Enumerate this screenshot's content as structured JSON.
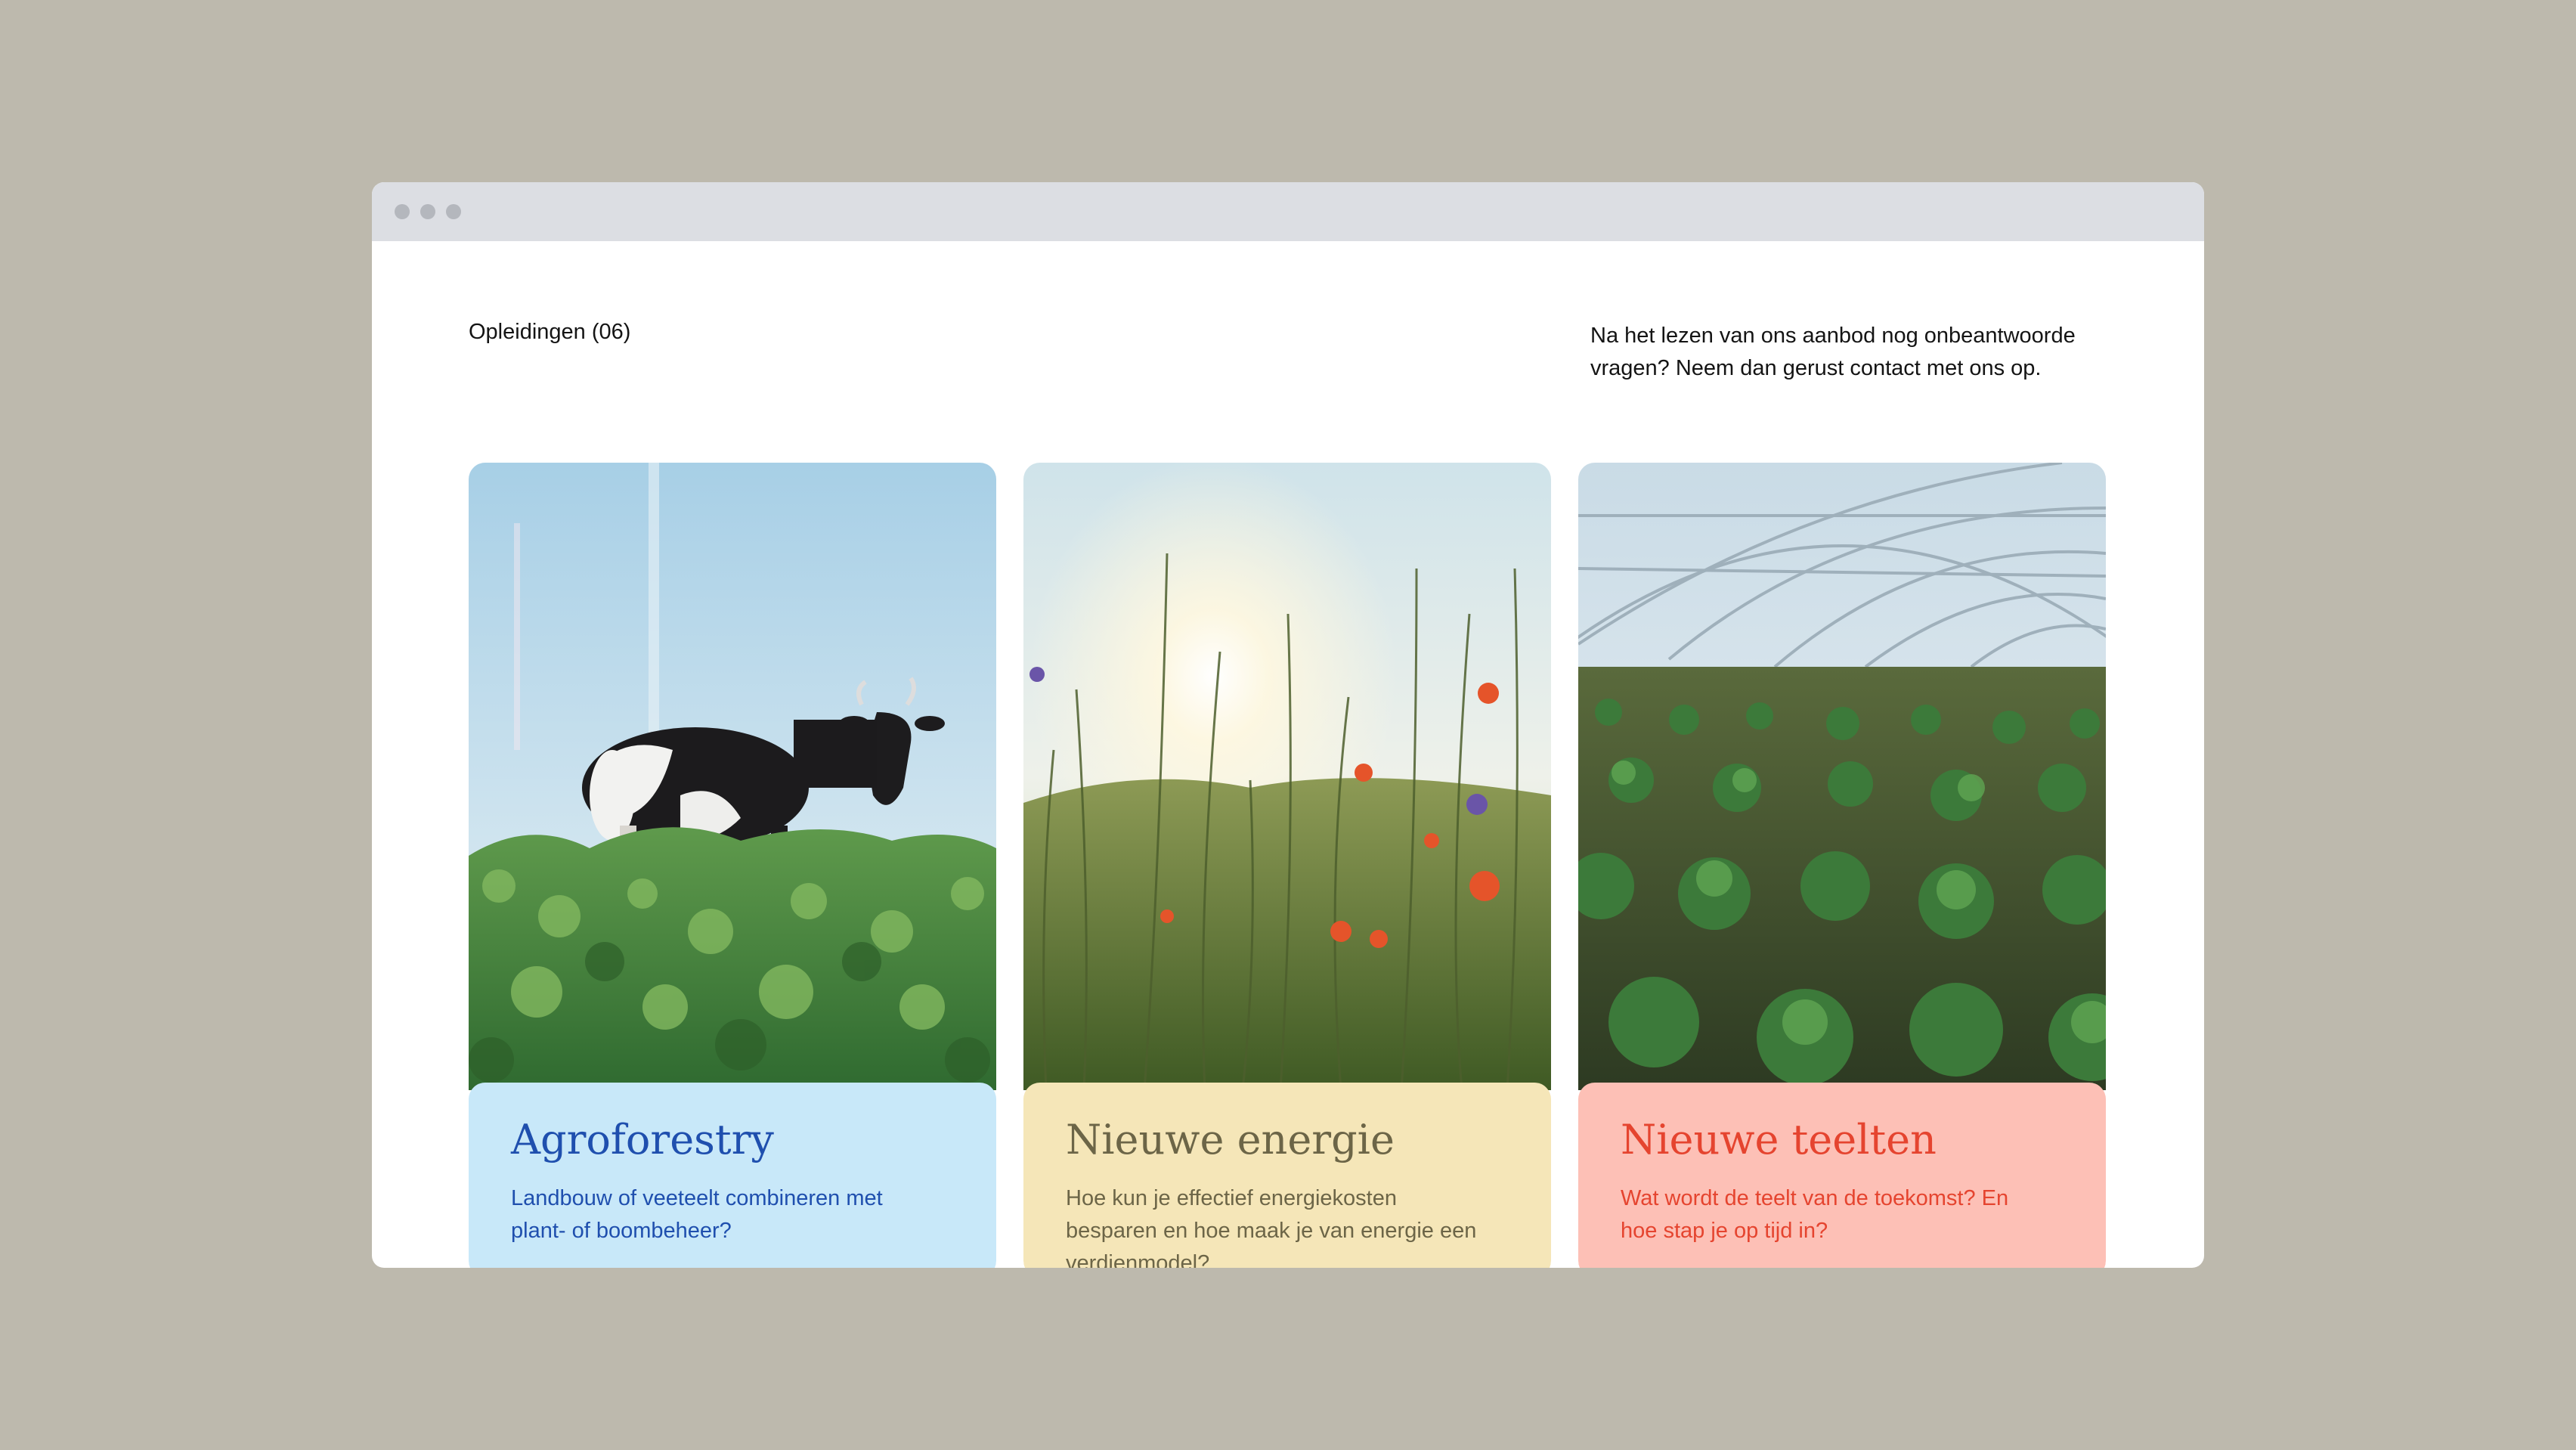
{
  "section": {
    "title": "Opleidingen (06)",
    "intro": "Na het lezen van ons aanbod nog onbeantwoorde vragen? Neem dan gerust contact met ons op."
  },
  "courses": [
    {
      "title": "Agroforestry",
      "description": "Landbouw of veeteelt combineren met plant- of boombeheer?",
      "image": "cow-in-meadow-photo",
      "color": "#c8e8f9",
      "text_color": "#1f4fae"
    },
    {
      "title": "Nieuwe energie",
      "description": "Hoe kun je effectief energiekosten besparen en hoe maak je van energie een verdienmodel?",
      "image": "wildflowers-sunlight-photo",
      "color": "#f5e6b8",
      "text_color": "#6c6547"
    },
    {
      "title": "Nieuwe teelten",
      "description": "Wat wordt de teelt van de toekomst? En hoe stap je op tijd in?",
      "image": "greenhouse-crops-photo",
      "color": "#fdc0b6",
      "text_color": "#e5442f"
    }
  ]
}
